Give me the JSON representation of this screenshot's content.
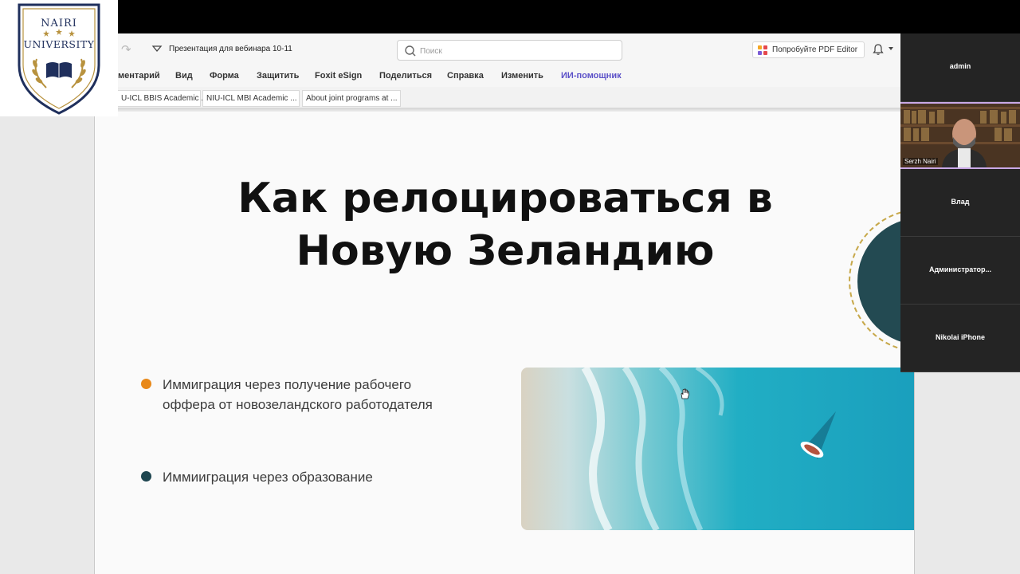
{
  "window": {
    "doc_title": "Презентация для вебинара 10-11",
    "search_placeholder": "Поиск",
    "pdf_editor_label": "Попробуйте PDF Editor"
  },
  "menu": {
    "items": [
      "ментарий",
      "Вид",
      "Форма",
      "Защитить",
      "Foxit eSign",
      "Поделиться",
      "Справка",
      "Изменить",
      "ИИ-помощник"
    ]
  },
  "tabs": [
    "U-ICL BBIS Academic ...",
    "NIU-ICL MBI Academic ...",
    "About joint programs at ..."
  ],
  "slide": {
    "title_lines": [
      "Как релоцироваться в",
      "Новую Зеландию"
    ],
    "bullets": [
      {
        "lines": [
          "Иммиграция через получение рабочего",
          "оффера от новозеландского работодателя"
        ],
        "color": "#e8891a"
      },
      {
        "lines": [
          "Иммииграция через образование"
        ],
        "color": "#1f4650"
      }
    ]
  },
  "participants": [
    "admin",
    "Serzh Nairi",
    "Влад",
    "Администратор...",
    "Nikolai iPhone"
  ],
  "logo": {
    "top_text": "NAIRI",
    "bottom_text": "UNIVERSITY",
    "gold": "#b8923e",
    "navy": "#1f2f5c"
  }
}
